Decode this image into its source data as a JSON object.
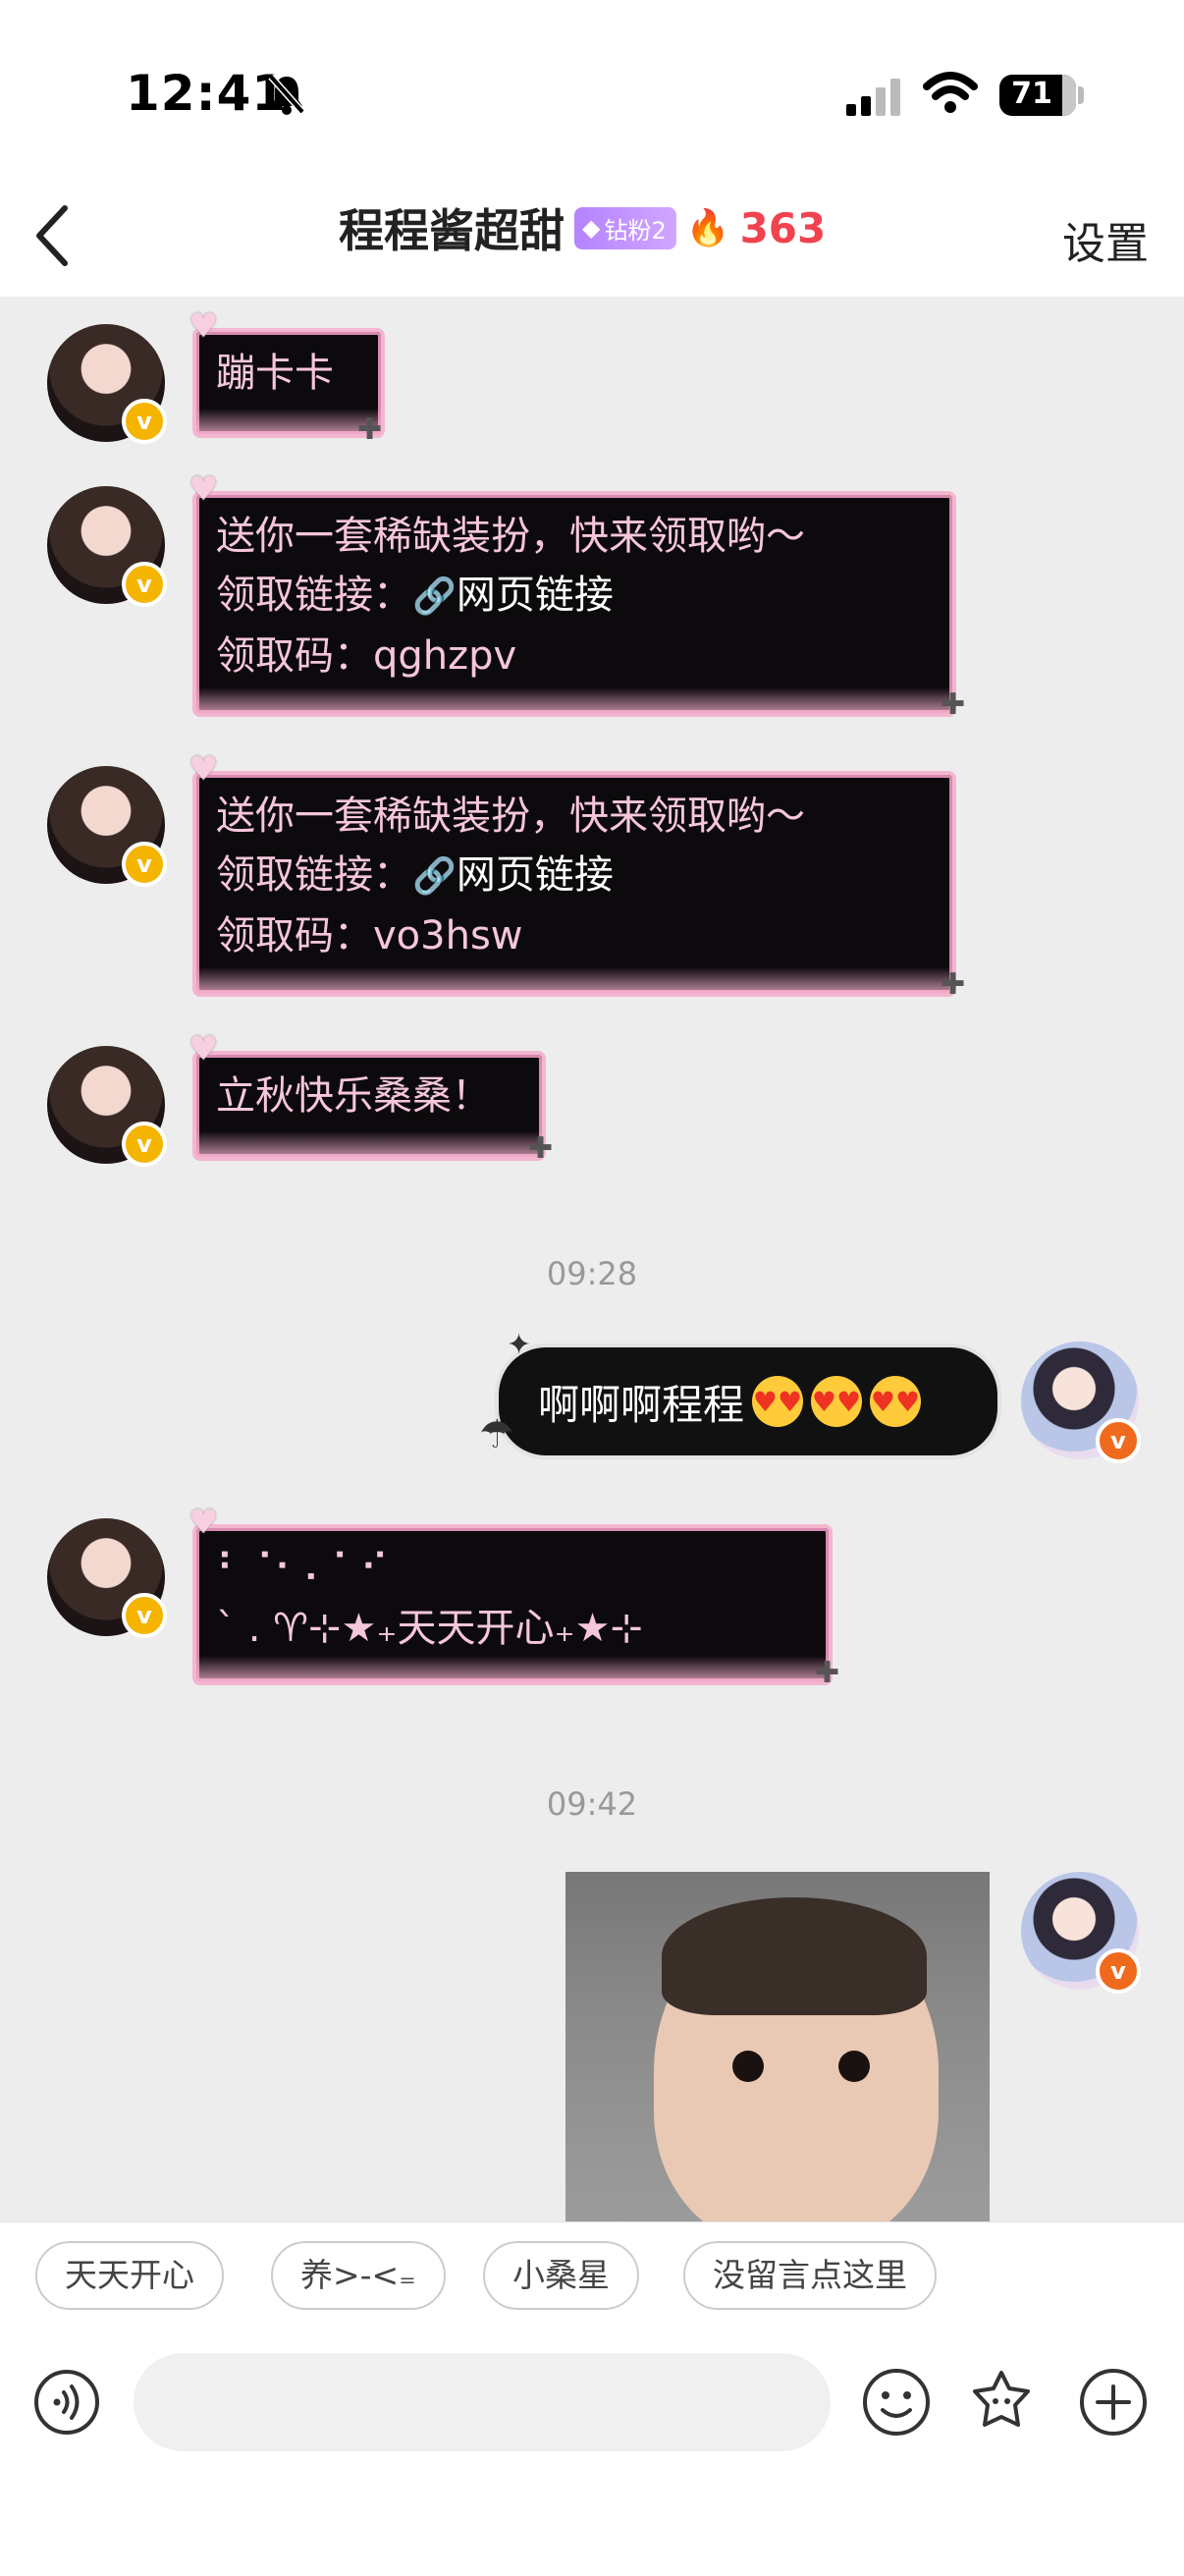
{
  "status_bar": {
    "time": "12:41",
    "battery": "71"
  },
  "header": {
    "title": "程程酱超甜",
    "fan_badge": "钻粉2",
    "streak_count": "363",
    "settings_label": "设置"
  },
  "messages": {
    "m1": {
      "text": "蹦卡卡"
    },
    "m2": {
      "line1": "送你一套稀缺装扮，快来领取哟～",
      "link_label": "领取链接：",
      "link_text": "网页链接",
      "code_label": "领取码：",
      "code": "qghzpv"
    },
    "m3": {
      "line1": "送你一套稀缺装扮，快来领取哟～",
      "link_label": "领取链接：",
      "link_text": "网页链接",
      "code_label": "领取码：",
      "code": "vo3hsw"
    },
    "m4": {
      "text": "立秋快乐桑桑！"
    },
    "time1": "09:28",
    "m5": {
      "text": "啊啊啊程程"
    },
    "m6": {
      "line1": "⠃⠈⠂⠄⠁⠊",
      "line2": "` . ♈⊹★₊天天开心₊★⊹"
    },
    "time2": "09:42"
  },
  "quick_replies": [
    "天天开心",
    "养>-<₌",
    "小桑星",
    "没留言点这里"
  ],
  "icons": {
    "back": "chevron-left-icon",
    "voice": "voice-icon",
    "emoji": "emoji-icon",
    "sticker": "sticker-icon",
    "add": "plus-icon"
  },
  "colors": {
    "bubble_bg": "#0d0a0d",
    "bubble_text": "#f6c6dc",
    "streak": "#f0434f",
    "fan_badge": "#b483ff"
  }
}
